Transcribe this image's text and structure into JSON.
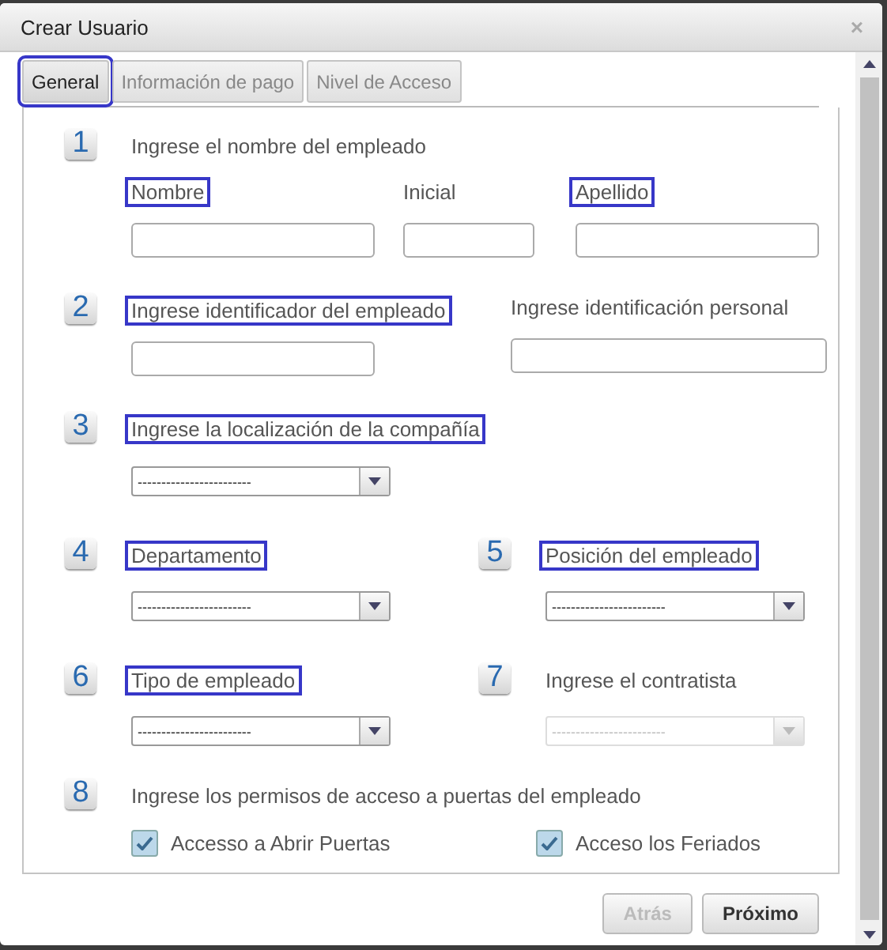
{
  "window": {
    "title": "Crear Usuario",
    "close": "×"
  },
  "tabs": [
    {
      "label": "General",
      "selected": true,
      "highlighted": true
    },
    {
      "label": "Información de pago",
      "selected": false,
      "highlighted": false
    },
    {
      "label": "Nivel de Acceso",
      "selected": false,
      "highlighted": false
    }
  ],
  "sections": [
    {
      "kind": "name",
      "number": "1",
      "title": "Ingrese el nombre del empleado",
      "fields": [
        {
          "label": "Nombre",
          "highlighted": true
        },
        {
          "label": "Inicial",
          "highlighted": false
        },
        {
          "label": "Apellido",
          "highlighted": true
        }
      ]
    },
    {
      "kind": "inputs",
      "number": "2",
      "fields": [
        {
          "label": "Ingrese identificador del empleado",
          "highlighted": true
        },
        {
          "label": "Ingrese identificación personal",
          "highlighted": false
        }
      ]
    },
    {
      "kind": "selects",
      "items": [
        {
          "number": "3",
          "label": "Ingrese la localización de la compañía",
          "highlighted": true,
          "value": "------------------------",
          "disabled": false
        }
      ]
    },
    {
      "kind": "selects",
      "items": [
        {
          "number": "4",
          "label": "Departamento",
          "highlighted": true,
          "value": "------------------------",
          "disabled": false
        },
        {
          "number": "5",
          "label": "Posición del empleado",
          "highlighted": true,
          "value": "------------------------",
          "disabled": false
        }
      ]
    },
    {
      "kind": "selects",
      "items": [
        {
          "number": "6",
          "label": "Tipo de empleado",
          "highlighted": true,
          "value": "------------------------",
          "disabled": false
        },
        {
          "number": "7",
          "label": "Ingrese el contratista",
          "highlighted": false,
          "value": "------------------------",
          "disabled": true
        }
      ]
    },
    {
      "kind": "checkboxes",
      "number": "8",
      "title": "Ingrese los permisos de acceso a puertas del empleado",
      "options": [
        {
          "label": "Accesso a Abrir Puertas",
          "checked": true
        },
        {
          "label": "Acceso los Feriados",
          "checked": true
        }
      ]
    }
  ],
  "buttons": [
    {
      "label": "Atrás",
      "disabled": true
    },
    {
      "label": "Próximo",
      "disabled": false
    }
  ]
}
